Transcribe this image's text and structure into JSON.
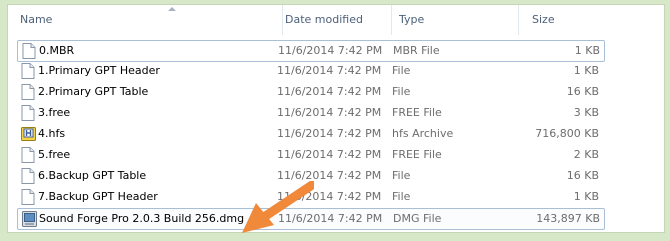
{
  "columns": {
    "name": "Name",
    "date_modified": "Date modified",
    "type": "Type",
    "size": "Size"
  },
  "files": [
    {
      "name": "0.MBR",
      "date": "11/6/2014 7:42 PM",
      "type": "MBR File",
      "size": "1 KB",
      "icon": "file-icon"
    },
    {
      "name": "1.Primary GPT Header",
      "date": "11/6/2014 7:42 PM",
      "type": "File",
      "size": "1 KB",
      "icon": "file-icon"
    },
    {
      "name": "2.Primary GPT Table",
      "date": "11/6/2014 7:42 PM",
      "type": "File",
      "size": "16 KB",
      "icon": "file-icon"
    },
    {
      "name": "3.free",
      "date": "11/6/2014 7:42 PM",
      "type": "FREE File",
      "size": "3 KB",
      "icon": "file-icon"
    },
    {
      "name": "4.hfs",
      "date": "11/6/2014 7:42 PM",
      "type": "hfs Archive",
      "size": "716,800 KB",
      "icon": "archive-icon"
    },
    {
      "name": "5.free",
      "date": "11/6/2014 7:42 PM",
      "type": "FREE File",
      "size": "2 KB",
      "icon": "file-icon"
    },
    {
      "name": "6.Backup GPT Table",
      "date": "11/6/2014 7:42 PM",
      "type": "File",
      "size": "16 KB",
      "icon": "file-icon"
    },
    {
      "name": "7.Backup GPT Header",
      "date": "11/6/2014 7:42 PM",
      "type": "File",
      "size": "1 KB",
      "icon": "file-icon"
    },
    {
      "name": "Sound Forge Pro 2.0.3 Build 256.dmg",
      "date": "11/6/2014 7:42 PM",
      "type": "DMG File",
      "size": "143,897 KB",
      "icon": "dmg-icon"
    }
  ],
  "colors": {
    "background": "#d7e8c8",
    "arrow": "#f0893a",
    "row_border": "#a9bfd6"
  }
}
